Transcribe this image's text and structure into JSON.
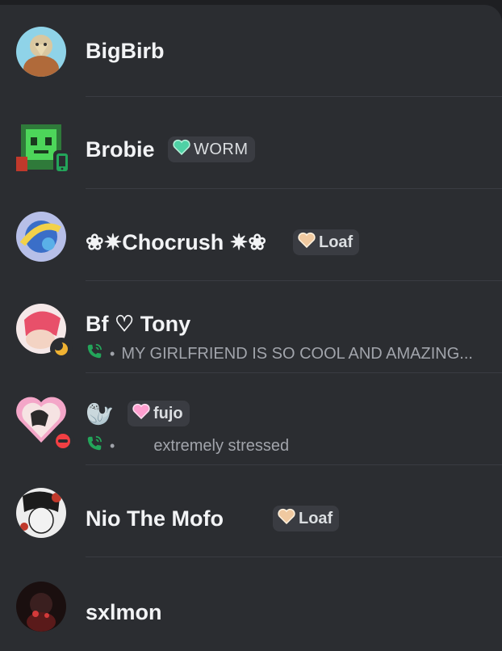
{
  "friends": [
    {
      "name": "BigBirb",
      "tag": null,
      "subtitle": null
    },
    {
      "name": "Brobie",
      "tag": "WORM",
      "tag_color": "#4fd1a5",
      "subtitle": null,
      "status": "mobile"
    },
    {
      "name": "❀✷Chocrush ✷❀",
      "tag": "Loaf",
      "tag_color": "#f0c9a0",
      "subtitle": null
    },
    {
      "name": "Bf ♡ Tony",
      "tag": null,
      "subtitle": "MY GIRLFRIEND IS SO COOL AND AMAZING...",
      "status": "idle",
      "activity": "voice-call"
    },
    {
      "name": "🦭",
      "tag": "fujo",
      "tag_color": "#ff9fd0",
      "subtitle": "extremely  stressed",
      "status": "dnd",
      "activity": "voice-call"
    },
    {
      "name": "Nio The Mofo",
      "tag": "Loaf",
      "tag_color": "#f0c9a0",
      "subtitle": null
    },
    {
      "name": "sxlmon",
      "tag": null,
      "subtitle": null
    }
  ],
  "colors": {
    "background": "#2b2d31",
    "call_icon": "#23a55a",
    "idle": "#f0b232",
    "dnd": "#f23f43",
    "mobile": "#23a55a"
  }
}
